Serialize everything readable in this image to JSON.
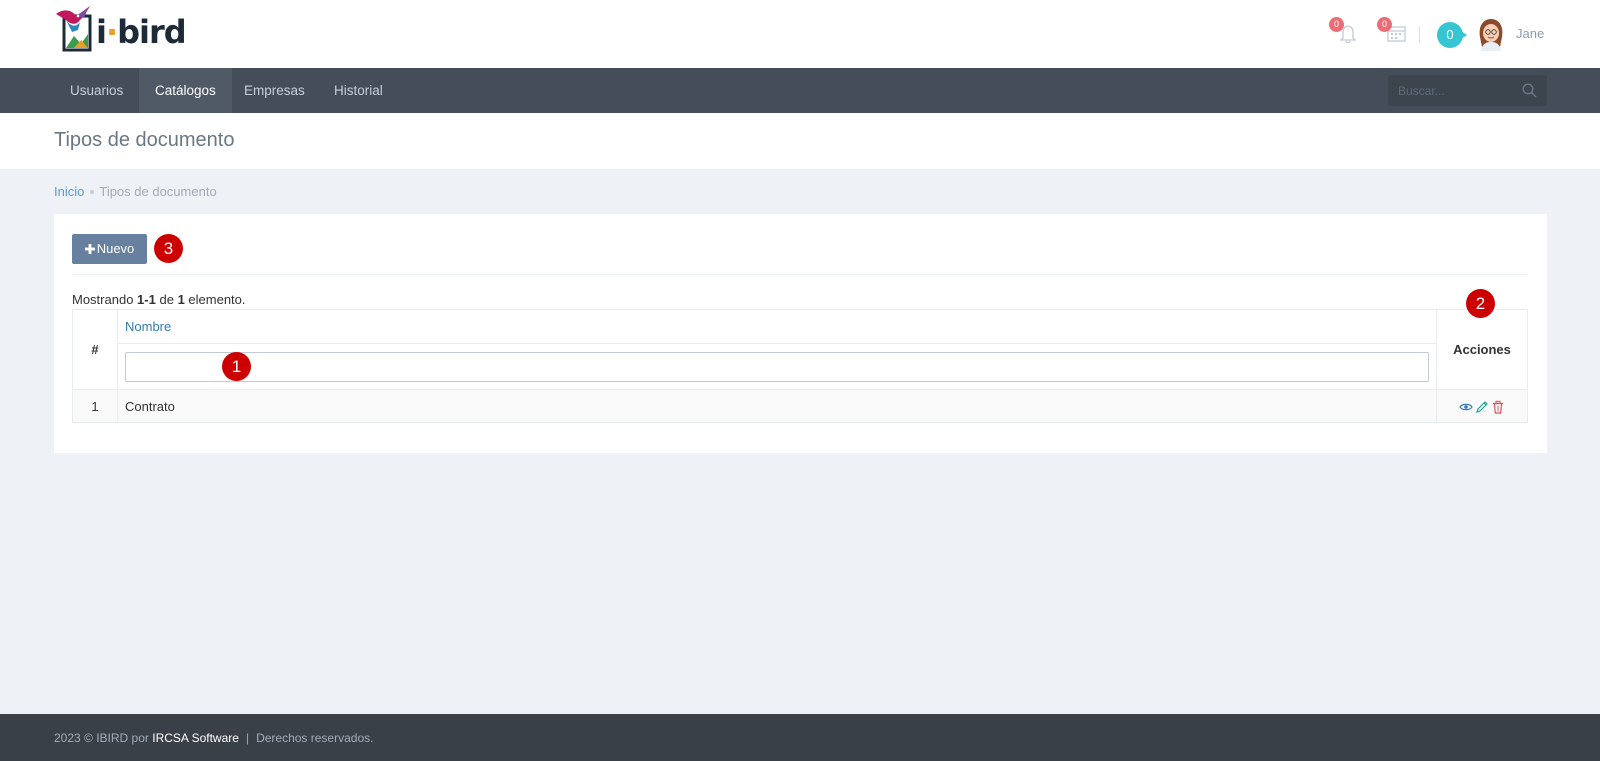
{
  "header": {
    "logo_text": "ibird",
    "notifications_count": "0",
    "calendar_count": "0",
    "counter": "0",
    "user_name": "Jane"
  },
  "nav": {
    "items": [
      {
        "label": "Usuarios"
      },
      {
        "label": "Catálogos"
      },
      {
        "label": "Empresas"
      },
      {
        "label": "Historial"
      }
    ],
    "active": "Catálogos",
    "search_placeholder": "Buscar..."
  },
  "page": {
    "title": "Tipos de documento",
    "breadcrumb": {
      "home": "Inicio",
      "current": "Tipos de documento"
    }
  },
  "toolbar": {
    "new_label": "Nuevo"
  },
  "summary": {
    "prefix": "Mostrando",
    "range": "1-1",
    "middle": "de",
    "total": "1",
    "suffix": "elemento."
  },
  "table": {
    "col_num": "#",
    "col_name": "Nombre",
    "col_actions": "Acciones",
    "filter_value": "",
    "rows": [
      {
        "num": "1",
        "name": "Contrato"
      }
    ]
  },
  "markers": {
    "m1": "1",
    "m2": "2",
    "m3": "3"
  },
  "footer": {
    "copyright": "2023 © IBIRD por",
    "company": "IRCSA Software",
    "pipe": "|",
    "rights": "Derechos reservados."
  },
  "colors": {
    "nav_bg": "#444d58",
    "button_bg": "#67809f",
    "marker": "#cc0000",
    "badge": "#ed6b75",
    "counter": "#36c6d3",
    "view_icon": "#337ab7",
    "edit_icon": "#26a69a",
    "delete_icon": "#e7505a"
  },
  "icons": {
    "notifications": "bell-icon",
    "calendar": "calendar-icon",
    "search": "search-icon",
    "new": "plus-icon",
    "view": "eye-icon",
    "edit": "pencil-icon",
    "delete": "trash-icon"
  }
}
